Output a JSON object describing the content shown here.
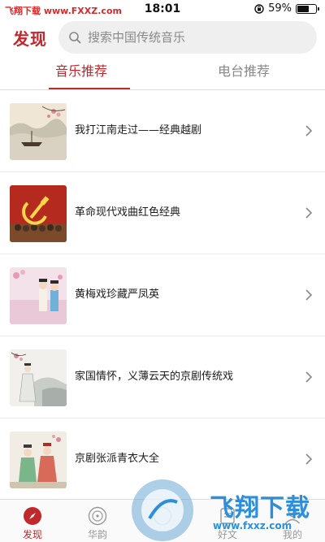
{
  "status_bar": {
    "carrier": "飞翔下载 www.FXXZ.com",
    "time": "18:01",
    "battery_percent": "59%",
    "battery_level": 0.59
  },
  "header": {
    "title": "发现",
    "search_placeholder": "搜索中国传统音乐"
  },
  "tabs": [
    {
      "label": "音乐推荐",
      "active": true
    },
    {
      "label": "电台推荐",
      "active": false
    }
  ],
  "list": [
    {
      "title": "我打江南走过——经典越剧",
      "icon": "landscape-boat-thumbnail"
    },
    {
      "title": "革命现代戏曲红色经典",
      "icon": "hammer-sickle-thumbnail"
    },
    {
      "title": "黄梅戏珍藏严凤英",
      "icon": "opera-performers-thumbnail"
    },
    {
      "title": "家国情怀，义薄云天的京剧传统戏",
      "icon": "ink-painting-figure-thumbnail"
    },
    {
      "title": "京剧张派青衣大全",
      "icon": "opera-costume-thumbnail"
    }
  ],
  "tabbar": [
    {
      "label": "发现",
      "icon": "compass-icon",
      "active": true
    },
    {
      "label": "华韵",
      "icon": "disc-icon",
      "active": false
    },
    {
      "label": "",
      "icon": "center-icon",
      "active": false
    },
    {
      "label": "好文",
      "icon": "article-icon",
      "active": false
    },
    {
      "label": "我的",
      "icon": "person-icon",
      "active": false
    }
  ],
  "watermark": {
    "text": "飞翔下载",
    "url": "www.fxxz.com"
  },
  "colors": {
    "accent": "#c0282c",
    "watermark": "#2d8fd9"
  }
}
